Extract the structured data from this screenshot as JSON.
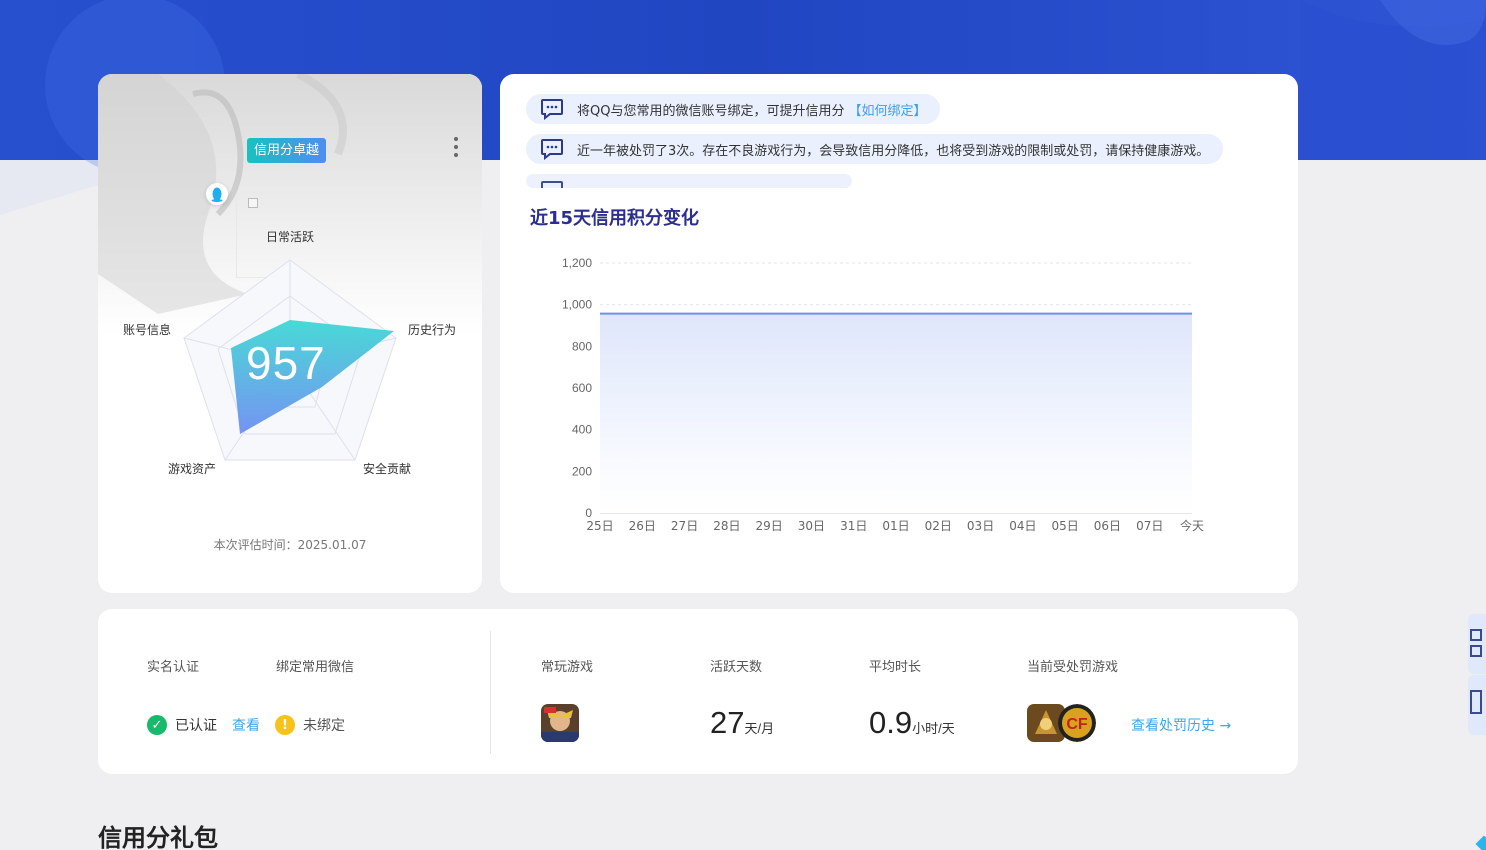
{
  "profile": {
    "badge": "信用分卓越",
    "score": "957",
    "radar_labels": {
      "top": "日常活跃",
      "right": "历史行为",
      "bottom_right": "安全贡献",
      "bottom_left": "游戏资产",
      "left": "账号信息"
    },
    "eval_time": "本次评估时间：2025.01.07"
  },
  "notices": [
    {
      "text": "将QQ与您常用的微信账号绑定，可提升信用分",
      "link": "【如何绑定】"
    },
    {
      "text": "近一年被处罚了3次。存在不良游戏行为，会导致信用分降低，也将受到游戏的限制或处罚，请保持健康游戏。"
    }
  ],
  "chart_title": "近15天信用积分变化",
  "chart_data": {
    "type": "area",
    "title": "近15天信用积分变化",
    "categories": [
      "25日",
      "26日",
      "27日",
      "28日",
      "29日",
      "30日",
      "31日",
      "01日",
      "02日",
      "03日",
      "04日",
      "05日",
      "06日",
      "07日",
      "今天"
    ],
    "series": [
      {
        "values": [
          957,
          957,
          957,
          957,
          957,
          957,
          957,
          957,
          957,
          957,
          957,
          957,
          957,
          957,
          957
        ]
      }
    ],
    "ylim": [
      0,
      1200
    ],
    "yticks": [
      "0",
      "200",
      "400",
      "600",
      "800",
      "1,000",
      "1,200"
    ],
    "grid": true,
    "color": "#6f92ef"
  },
  "stats": {
    "realname_label": "实名认证",
    "wechat_label": "绑定常用微信",
    "realname_status": "已认证",
    "realname_link": "查看",
    "wechat_status": "未绑定",
    "games_label": "常玩游戏",
    "active_days_label": "活跃天数",
    "active_days_value": "27",
    "active_days_unit": "天/月",
    "avg_time_label": "平均时长",
    "avg_time_value": "0.9",
    "avg_time_unit": "小时/天",
    "punished_label": "当前受处罚游戏",
    "history_link": "查看处罚历史 →"
  },
  "gift_section_title": "信用分礼包",
  "colors": {
    "banner": "#2448c8",
    "accent_teal": "#19c1c0",
    "link": "#3aa8ee",
    "ok_green": "#19b96b",
    "warn_yellow": "#f7c21a"
  }
}
